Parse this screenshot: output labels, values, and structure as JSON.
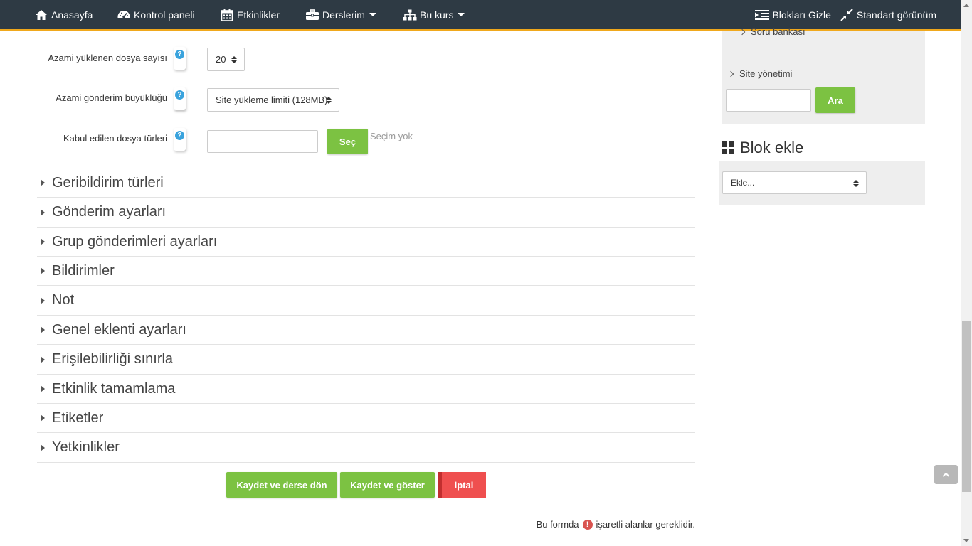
{
  "navbar": {
    "items": [
      {
        "label": "Anasayfa",
        "icon": "home-icon"
      },
      {
        "label": "Kontrol paneli",
        "icon": "dashboard-icon"
      },
      {
        "label": "Etkinlikler",
        "icon": "calendar-icon"
      },
      {
        "label": "Derslerim",
        "icon": "briefcase-icon",
        "dropdown": true
      },
      {
        "label": "Bu kurs",
        "icon": "sitemap-icon",
        "dropdown": true
      }
    ],
    "right": [
      {
        "label": "Blokları Gizle",
        "icon": "indent-icon"
      },
      {
        "label": "Standart görünüm",
        "icon": "compress-icon"
      }
    ],
    "bg_color": "#2e3a44",
    "accent_color": "#f0a81c"
  },
  "form": {
    "max_files": {
      "label": "Azami yüklenen dosya sayısı",
      "value": "20"
    },
    "max_size": {
      "label": "Azami gönderim büyüklüğü",
      "value": "Site yükleme limiti (128MB)"
    },
    "file_types": {
      "label": "Kabul edilen dosya türleri",
      "button": "Seç",
      "status": "Seçim yok",
      "value": ""
    }
  },
  "sections": [
    "Geribildirim türleri",
    "Gönderim ayarları",
    "Grup gönderimleri ayarları",
    "Bildirimler",
    "Not",
    "Genel eklenti ayarları",
    "Erişilebilirliği sınırla",
    "Etkinlik tamamlama",
    "Etiketler",
    "Yetkinlikler"
  ],
  "buttons": {
    "save_return": "Kaydet ve derse dön",
    "save_display": "Kaydet ve göster",
    "cancel": "İptal"
  },
  "required_note": {
    "before": "Bu formda",
    "after": "işaretli alanlar gereklidir."
  },
  "sidebar": {
    "partial_item": "Soru bankası",
    "site_admin": "Site yönetimi",
    "search_value": "",
    "search_button": "Ara",
    "add_block_title": "Blok ekle",
    "add_block_select": "Ekle..."
  },
  "colors": {
    "green": "#7cc242",
    "red": "#ef4f4f",
    "help_blue": "#3aa3dd"
  }
}
